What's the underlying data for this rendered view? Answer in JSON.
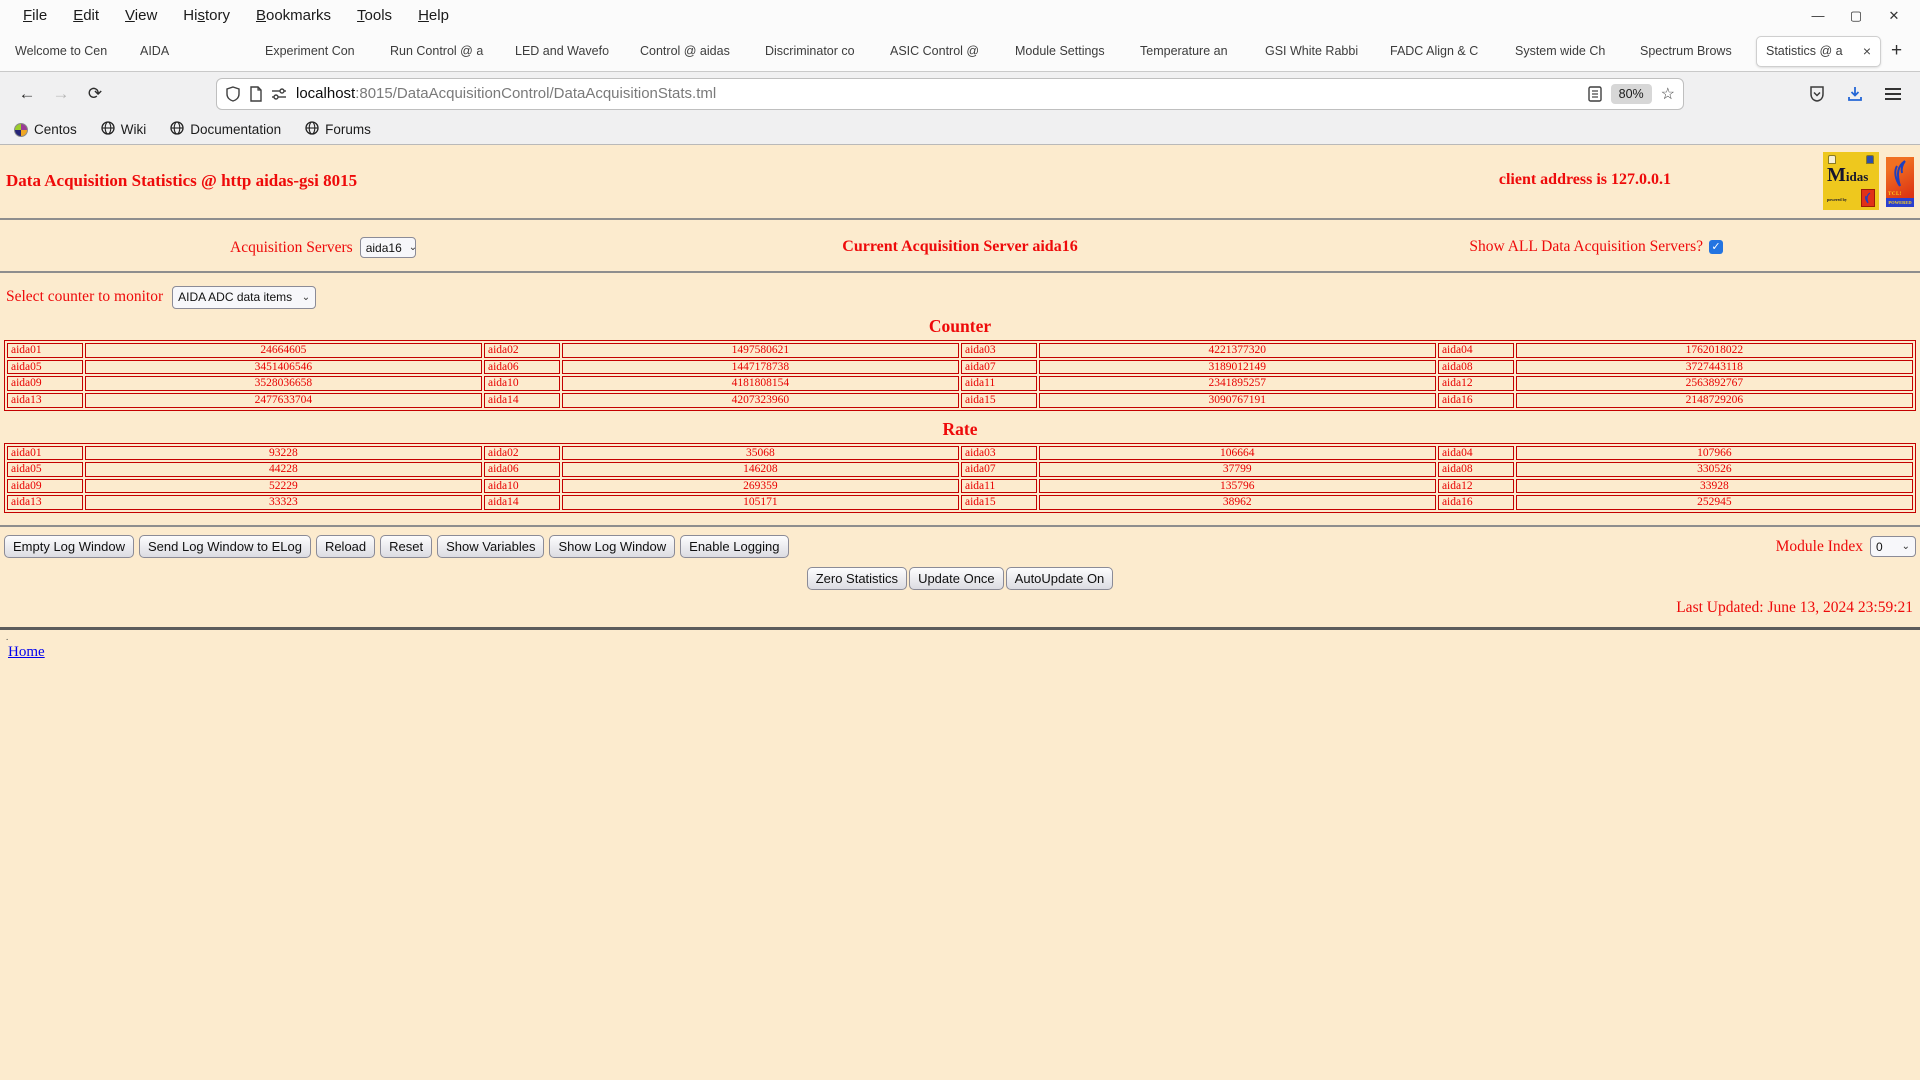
{
  "browser": {
    "menu": [
      {
        "label": "File",
        "u": 0
      },
      {
        "label": "Edit",
        "u": 0
      },
      {
        "label": "View",
        "u": 0
      },
      {
        "label": "History",
        "u": 2
      },
      {
        "label": "Bookmarks",
        "u": 0
      },
      {
        "label": "Tools",
        "u": 0
      },
      {
        "label": "Help",
        "u": 0
      }
    ],
    "window_controls": {
      "minimize": "—",
      "maximize": "▢",
      "close": "✕"
    },
    "tabs": [
      "Welcome to Cen",
      "AIDA",
      "Experiment Con",
      "Run Control @ a",
      "LED and Wavefo",
      "Control @ aidas",
      "Discriminator co",
      "ASIC Control @",
      "Module Settings",
      "Temperature an",
      "GSI White Rabbi",
      "FADC Align & C",
      "System wide Ch",
      "Spectrum Brows",
      "Statistics @ a"
    ],
    "active_tab": 14,
    "new_tab_label": "+",
    "url_host": "localhost",
    "url_path": ":8015/DataAcquisitionControl/DataAcquisitionStats.tml",
    "zoom_badge": "80%",
    "bookmarks": [
      {
        "label": "Centos",
        "icon": "centos-icon"
      },
      {
        "label": "Wiki",
        "icon": "globe-icon"
      },
      {
        "label": "Documentation",
        "icon": "globe-icon"
      },
      {
        "label": "Forums",
        "icon": "globe-icon"
      }
    ]
  },
  "page": {
    "title": "Data Acquisition Statistics @ http aidas-gsi 8015",
    "client_address": "client address is 127.0.0.1",
    "acq_servers_label": "Acquisition Servers",
    "acq_server_value": "aida16",
    "current_server": "Current Acquisition Server aida16",
    "show_all_label": "Show ALL Data Acquisition Servers?",
    "show_all_checked": true,
    "counter_select_label": "Select counter to monitor",
    "counter_select_value": "AIDA ADC data items",
    "counter_heading": "Counter",
    "rate_heading": "Rate",
    "counter_rows": [
      [
        [
          "aida01",
          "24664605"
        ],
        [
          "aida02",
          "1497580621"
        ],
        [
          "aida03",
          "4221377320"
        ],
        [
          "aida04",
          "1762018022"
        ]
      ],
      [
        [
          "aida05",
          "3451406546"
        ],
        [
          "aida06",
          "1447178738"
        ],
        [
          "aida07",
          "3189012149"
        ],
        [
          "aida08",
          "3727443118"
        ]
      ],
      [
        [
          "aida09",
          "3528036658"
        ],
        [
          "aida10",
          "4181808154"
        ],
        [
          "aida11",
          "2341895257"
        ],
        [
          "aida12",
          "2563892767"
        ]
      ],
      [
        [
          "aida13",
          "2477633704"
        ],
        [
          "aida14",
          "4207323960"
        ],
        [
          "aida15",
          "3090767191"
        ],
        [
          "aida16",
          "2148729206"
        ]
      ]
    ],
    "rate_rows": [
      [
        [
          "aida01",
          "93228"
        ],
        [
          "aida02",
          "35068"
        ],
        [
          "aida03",
          "106664"
        ],
        [
          "aida04",
          "107966"
        ]
      ],
      [
        [
          "aida05",
          "44228"
        ],
        [
          "aida06",
          "146208"
        ],
        [
          "aida07",
          "37799"
        ],
        [
          "aida08",
          "330526"
        ]
      ],
      [
        [
          "aida09",
          "52229"
        ],
        [
          "aida10",
          "269359"
        ],
        [
          "aida11",
          "135796"
        ],
        [
          "aida12",
          "33928"
        ]
      ],
      [
        [
          "aida13",
          "33323"
        ],
        [
          "aida14",
          "105171"
        ],
        [
          "aida15",
          "38962"
        ],
        [
          "aida16",
          "252945"
        ]
      ]
    ],
    "log_buttons": [
      "Empty Log Window",
      "Send Log Window to ELog",
      "Reload",
      "Reset",
      "Show Variables",
      "Show Log Window",
      "Enable Logging"
    ],
    "module_index_label": "Module Index",
    "module_index_value": "0",
    "update_buttons": [
      "Zero Statistics",
      "Update Once",
      "AutoUpdate On"
    ],
    "last_updated": "Last Updated: June 13, 2024 23:59:21",
    "footer_dot": ".",
    "home_link": "Home",
    "logos": {
      "midas_word": "idas",
      "midas_m": "M",
      "midas_powered": "powered by",
      "tcl_text": "TCL!",
      "tcl_strip": "POWERED"
    }
  },
  "colors": {
    "page_bg": "#fcebce",
    "text_red": "#ee0a0a",
    "border_red": "#c40000",
    "link_blue": "#0000ee",
    "checkbox_blue": "#2374e1",
    "download_blue": "#2467d6"
  }
}
